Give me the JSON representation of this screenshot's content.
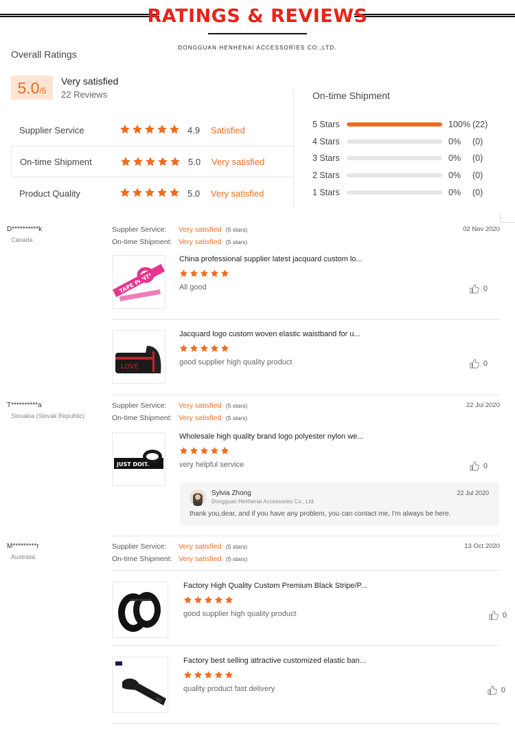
{
  "header": {
    "title": "RATINGS & REVIEWS",
    "company": "DONGGUAN HENHENAI ACCESSORIES CO.,LTD."
  },
  "overall": {
    "title": "Overall Ratings",
    "score": "5.0",
    "score_max": "/5",
    "label": "Very satisfied",
    "reviews": "22 Reviews",
    "metrics": [
      {
        "label": "Supplier Service",
        "stars": 5,
        "score": "4.9",
        "text": "Satisfied"
      },
      {
        "label": "On-time Shipment",
        "stars": 5,
        "score": "5.0",
        "text": "Very satisfied"
      },
      {
        "label": "Product Quality",
        "stars": 5,
        "score": "5.0",
        "text": "Very satisfied"
      }
    ]
  },
  "shipment": {
    "title": "On-time Shipment",
    "rows": [
      {
        "label": "5  Stars",
        "fill": 1.0,
        "pct": "100%",
        "count": "(22)"
      },
      {
        "label": "4  Stars",
        "fill": 0,
        "pct": "0%",
        "count": "(0)"
      },
      {
        "label": "3  Stars",
        "fill": 0,
        "pct": "0%",
        "count": "(0)"
      },
      {
        "label": "2  Stars",
        "fill": 0,
        "pct": "0%",
        "count": "(0)"
      },
      {
        "label": "1  Stars",
        "fill": 0,
        "pct": "0%",
        "count": "(0)"
      }
    ]
  },
  "labels": {
    "supplier_service": "Supplier Service:",
    "on_time_shipment": "On-time Shipment:"
  },
  "reviews": [
    {
      "user": "D**********k",
      "country": "Canada",
      "date": "02 Nov 2020",
      "supplier_service": "Very satisfied",
      "supplier_service_count": "(5 stars)",
      "shipment": "Very satisfied",
      "shipment_count": "(5 stars)",
      "products": [
        {
          "title": "China professional supplier latest jacquard custom lo...",
          "stars": 5,
          "comment": "All good",
          "likes": "0"
        },
        {
          "title": "Jacquard logo custom woven elastic waistband for u...",
          "stars": 5,
          "comment": "good supplier high quality product",
          "likes": "0"
        }
      ]
    },
    {
      "user": "T**********a",
      "country": "Slovakia (Slovak Republic)",
      "date": "22 Jul 2020",
      "supplier_service": "Very satisfied",
      "supplier_service_count": "(5 stars)",
      "shipment": "Very satisfied",
      "shipment_count": "(5 stars)",
      "products": [
        {
          "title": "Wholesale high quality brand logo polyester nylon we...",
          "stars": 5,
          "comment": "very helpful service",
          "likes": "0"
        }
      ],
      "reply": {
        "name": "Sylvia Zhong",
        "company": "Dongguan Henhenai Accessories Co., Ltd.",
        "date": "22 Jul 2020",
        "text": "thank you,dear, and if you have any problem, you can contact me, I'm always be here."
      }
    },
    {
      "user": "M*********r",
      "country": "Australia",
      "date": "13 Oct 2020",
      "supplier_service": "Very satisfied",
      "supplier_service_count": "(5 stars)",
      "shipment": "Very satisfied",
      "shipment_count": "(5 stars)",
      "products": [
        {
          "title": "Factory High Quality Custom Premium Black Stripe/P...",
          "stars": 5,
          "comment": "good supplier high quality product",
          "likes": "0"
        },
        {
          "title": "Factory best selling attractive customized elastic ban...",
          "stars": 5,
          "comment": "quality product fast delivery",
          "likes": "0"
        }
      ]
    }
  ],
  "thumb_text": {
    "p1": "TAPE PANTS",
    "p2": "LOVE",
    "p3": "JUST DOIT.",
    "p5": "YO"
  },
  "colors": {
    "accent": "#f06b1e",
    "title_red": "#e8231a"
  }
}
